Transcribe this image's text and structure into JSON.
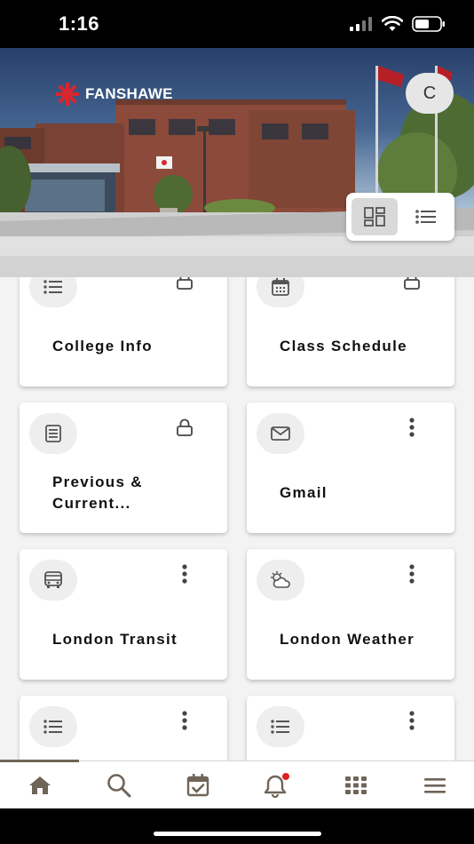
{
  "status_bar": {
    "time": "1:16"
  },
  "header": {
    "logo_text": "FANSHAWE",
    "avatar_initial": "C",
    "view_toggle": {
      "active": "grid"
    }
  },
  "cards": [
    {
      "title": "College Info",
      "icon": "list-icon",
      "corner": "lock-icon"
    },
    {
      "title": "Class Schedule",
      "icon": "calendar-icon",
      "corner": "lock-icon"
    },
    {
      "title": "Previous & Current...",
      "icon": "book-icon",
      "corner": "lock-icon"
    },
    {
      "title": "Gmail",
      "icon": "mail-icon",
      "corner": "more-icon"
    },
    {
      "title": "London Transit",
      "icon": "bus-icon",
      "corner": "more-icon"
    },
    {
      "title": "London Weather",
      "icon": "weather-icon",
      "corner": "more-icon"
    },
    {
      "title": "",
      "icon": "list-icon",
      "corner": "more-icon"
    },
    {
      "title": "",
      "icon": "list-icon",
      "corner": "more-icon"
    }
  ],
  "bottom_nav": {
    "active": "home",
    "items": [
      "home-icon",
      "search-icon",
      "calendar-check-icon",
      "bell-icon",
      "apps-grid-icon",
      "menu-icon"
    ],
    "notification_color": "#e02020"
  },
  "colors": {
    "brand_red": "#d7262f",
    "icon_gray": "#555555",
    "nav_icon": "#6f6458"
  }
}
